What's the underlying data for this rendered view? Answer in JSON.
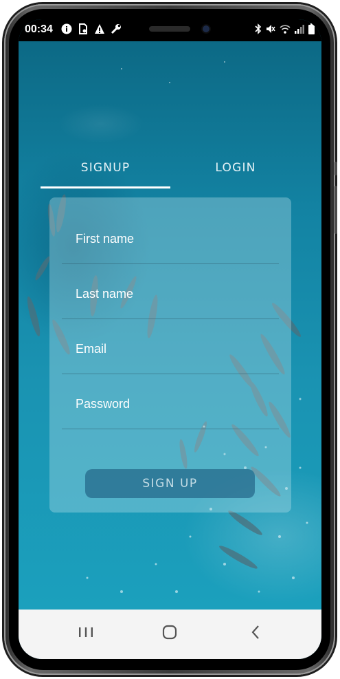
{
  "status_bar": {
    "time": "00:34",
    "left_icons": [
      "info-icon",
      "sim-settings-icon",
      "warning-icon",
      "wrench-icon"
    ],
    "right_icons": [
      "bluetooth-icon",
      "mute-icon",
      "wifi-icon",
      "signal-icon",
      "battery-icon"
    ]
  },
  "tabs": [
    {
      "label": "SIGNUP",
      "active": true
    },
    {
      "label": "LOGIN",
      "active": false
    }
  ],
  "form": {
    "fields": [
      {
        "label": "First name",
        "value": ""
      },
      {
        "label": "Last name",
        "value": ""
      },
      {
        "label": "Email",
        "value": ""
      },
      {
        "label": "Password",
        "value": ""
      }
    ],
    "submit_label": "SIGN UP"
  },
  "nav_bar": {
    "buttons": [
      "recent-apps-icon",
      "home-icon",
      "back-icon"
    ]
  },
  "colors": {
    "ocean": "#1383a3",
    "card": "#bee1eb",
    "button": "#1e5f82",
    "tab_indicator": "#ffffff"
  }
}
